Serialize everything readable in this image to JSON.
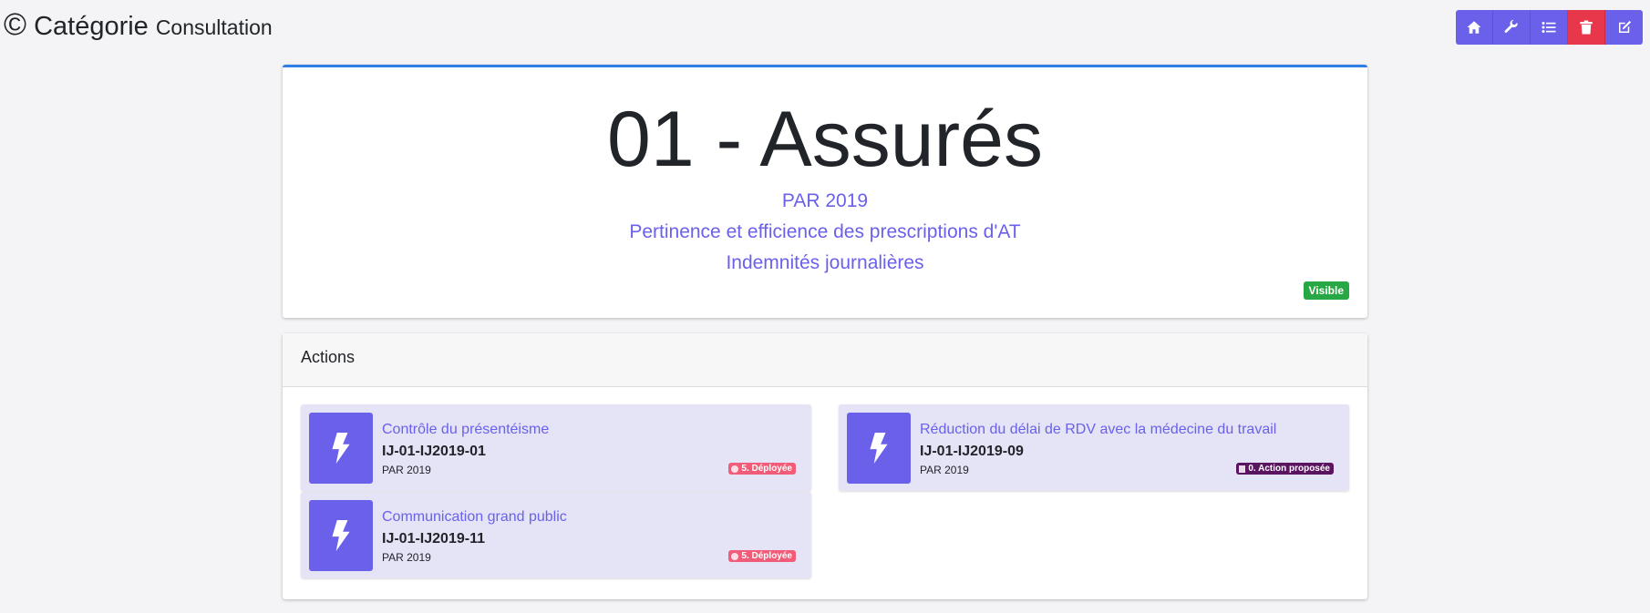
{
  "header": {
    "icon": "copyright-icon",
    "title": "Catégorie",
    "subtitle": "Consultation"
  },
  "toolbar": {
    "buttons": [
      {
        "name": "home-icon"
      },
      {
        "name": "wrench-icon"
      },
      {
        "name": "list-icon"
      },
      {
        "name": "trash-icon"
      },
      {
        "name": "edit-icon"
      }
    ]
  },
  "hero": {
    "title": "01 - Assurés",
    "line1": "PAR 2019",
    "line2": "Pertinence et efficience des prescriptions d'AT",
    "line3": "Indemnités journalières",
    "badge": "Visible"
  },
  "actions": {
    "header": "Actions",
    "items": [
      {
        "title": "Contrôle du présentéisme",
        "code": "IJ-01-IJ2019-01",
        "program": "PAR 2019",
        "status": "5. Déployée"
      },
      {
        "title": "Réduction du délai de RDV avec la médecine du travail",
        "code": "IJ-01-IJ2019-09",
        "program": "PAR 2019",
        "status": "0. Action proposée"
      },
      {
        "title": "Communication grand public",
        "code": "IJ-01-IJ2019-11",
        "program": "PAR 2019",
        "status": "5. Déployée"
      }
    ]
  },
  "colors": {
    "accent": "#6a60ea",
    "danger": "#e8364a",
    "border_top": "#2f7ee6",
    "status_deployed": "#f25c78",
    "status_proposed": "#5a1460",
    "visible": "#28a745"
  }
}
